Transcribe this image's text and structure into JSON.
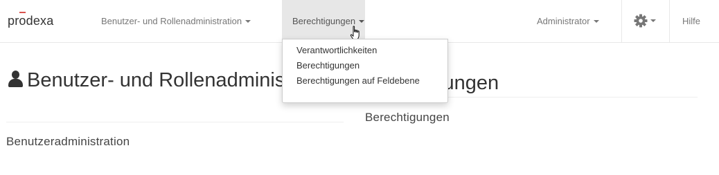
{
  "navbar": {
    "brand": {
      "prefix": "pr",
      "o": "o",
      "suffix": "dexa",
      "accent_color": "#d9534f"
    },
    "items": {
      "user_admin": "Benutzer- und Rollenadministration",
      "permissions": "Berechtigungen",
      "admin": "Administrator",
      "settings_icon": "gear-icon",
      "help": "Hilfe"
    }
  },
  "dropdown": {
    "items": [
      "Verantwortlichkeiten",
      "Berechtigungen",
      "Berechtigungen auf Feldebene"
    ]
  },
  "sections": {
    "left": {
      "icon": "user-icon",
      "title": "Benutzer- und Rollenadministration",
      "links": [
        "Benutzeradministration"
      ]
    },
    "right": {
      "title": "Berechtigungen",
      "links": [
        "Berechtigungen"
      ]
    }
  },
  "colors": {
    "active_nav_bg": "#e7e7e7",
    "nav_text": "#777777",
    "text": "#333333"
  }
}
